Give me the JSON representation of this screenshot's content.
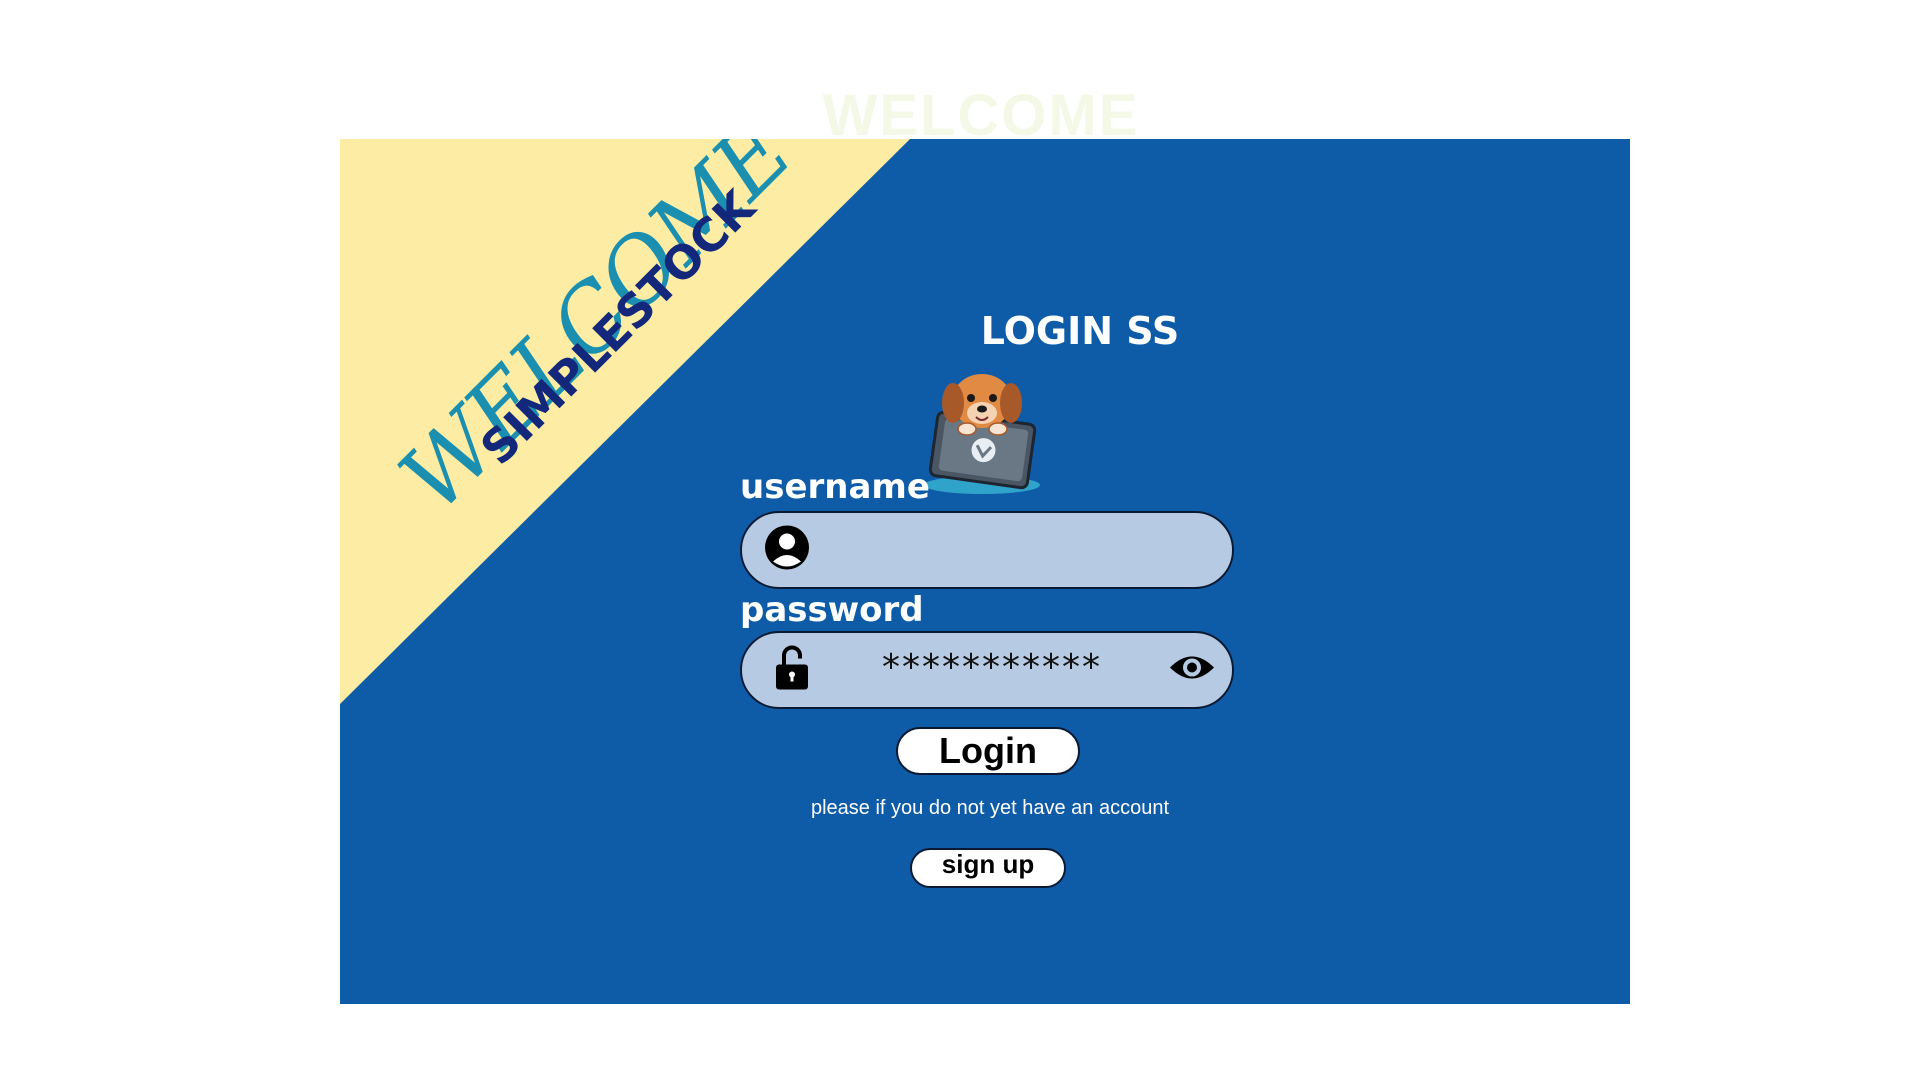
{
  "page": {
    "faded_title": "WELCOME"
  },
  "banner": {
    "welcome": "WELCOME",
    "brand": "SIMPLESTOCK"
  },
  "login": {
    "heading": "LOGIN SS",
    "username_label": "username",
    "username_value": "",
    "password_label": "password",
    "password_value": "***********",
    "login_button": "Login",
    "signup_hint": "please if you do not yet have an account",
    "signup_button": "sign up"
  },
  "icons": {
    "username_field": "user-circle-icon",
    "password_field": "unlock-icon",
    "password_toggle": "eye-icon",
    "mascot": "puppy-laptop-icon"
  },
  "colors": {
    "card_background": "#0e5ca8",
    "corner_background": "#fdeda4",
    "welcome_text": "#1a8fb0",
    "brand_text": "#13287a",
    "field_background": "#b6cae3",
    "faded_title": "#f3f9e6"
  }
}
